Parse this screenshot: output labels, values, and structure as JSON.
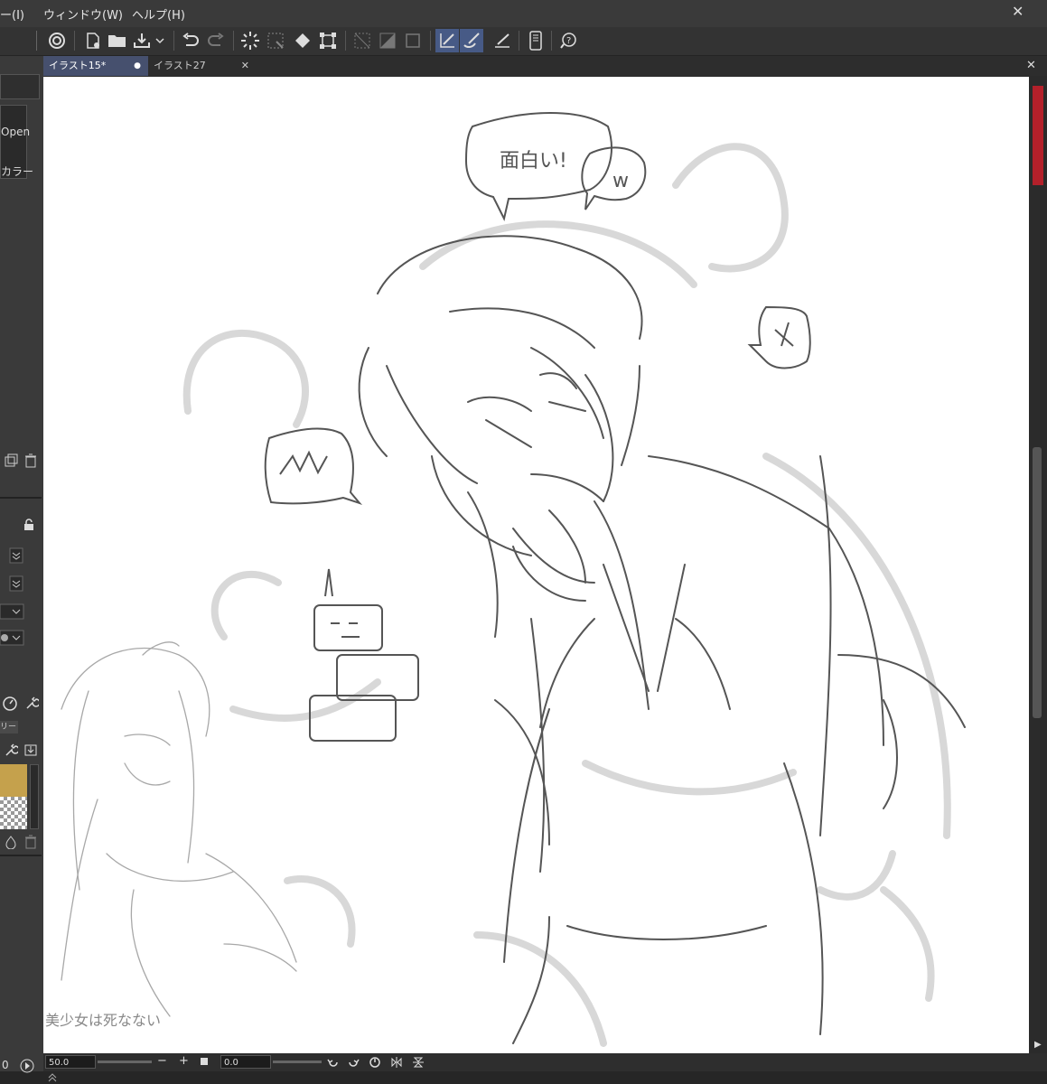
{
  "menubar": {
    "items": [
      "ー(I)",
      "ウィンドウ(W)",
      "ヘルプ(H)"
    ]
  },
  "tabs": [
    {
      "label": "イラスト15*",
      "modified_dot": "●"
    },
    {
      "label": "イラスト27",
      "close": "✕"
    }
  ],
  "window": {
    "close": "✕",
    "tab_close": "✕"
  },
  "left_panel": {
    "brush_items": [
      "Open",
      "カラー"
    ],
    "layer_tab_label": "リー"
  },
  "canvas_text": {
    "bubble_top": "面白い!",
    "bubble_w": "w",
    "handwritten_caption": "美少女は死なない"
  },
  "statusbar": {
    "zoom": "50.0",
    "rotation": "0.0",
    "minus": "−",
    "plus": "+"
  },
  "bottom": {
    "left_value": "0"
  },
  "colors": {
    "accent_active": "#475a86",
    "tab_active": "#46506e",
    "swatch_main": "#c5a14c",
    "red_stripe": "#b3202a"
  }
}
